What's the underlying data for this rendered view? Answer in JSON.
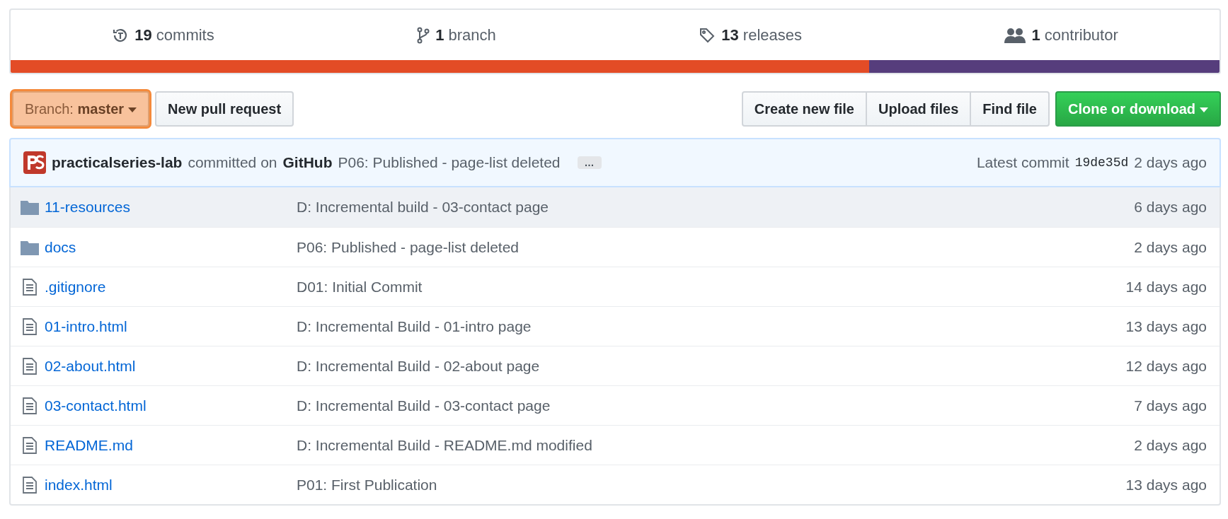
{
  "stats": [
    {
      "kind": "commits",
      "count": "19",
      "label": "commits"
    },
    {
      "kind": "branch",
      "count": "1",
      "label": "branch"
    },
    {
      "kind": "releases",
      "count": "13",
      "label": "releases"
    },
    {
      "kind": "contributors",
      "count": "1",
      "label": "contributor"
    }
  ],
  "languages": [
    {
      "color": "#e34c26",
      "level": 0.71
    },
    {
      "color": "#563d7c",
      "level": 0.29
    }
  ],
  "branch_button": {
    "label": "Branch:",
    "value": "master",
    "focused": true
  },
  "pull_request_button": "New pull request",
  "file_buttons": [
    "Create new file",
    "Upload files",
    "Find file"
  ],
  "clone_button": "Clone or download",
  "latest_commit": {
    "author": "practicalseries-lab",
    "action": "committed on",
    "platform": "GitHub",
    "message": "P06: Published - page-list deleted",
    "more": "…",
    "label": "Latest commit",
    "sha": "19de35d",
    "age": "2 days ago"
  },
  "files": [
    {
      "kind": "folder",
      "name": "11-resources",
      "message": "D: Incremental build - 03-contact page",
      "age": "6 days ago",
      "selected": true
    },
    {
      "kind": "folder",
      "name": "docs",
      "message": "P06: Published - page-list deleted",
      "age": "2 days ago",
      "selected": false
    },
    {
      "kind": "file",
      "name": ".gitignore",
      "message": "D01: Initial Commit",
      "age": "14 days ago",
      "selected": false
    },
    {
      "kind": "file",
      "name": "01-intro.html",
      "message": "D: Incremental Build - 01-intro page",
      "age": "13 days ago",
      "selected": false
    },
    {
      "kind": "file",
      "name": "02-about.html",
      "message": "D: Incremental Build - 02-about page",
      "age": "12 days ago",
      "selected": false
    },
    {
      "kind": "file",
      "name": "03-contact.html",
      "message": "D: Incremental Build - 03-contact page",
      "age": "7 days ago",
      "selected": false
    },
    {
      "kind": "file",
      "name": "README.md",
      "message": "D: Incremental Build - README.md modified",
      "age": "2 days ago",
      "selected": false
    },
    {
      "kind": "file",
      "name": "index.html",
      "message": "P01: First Publication",
      "age": "13 days ago",
      "selected": false
    }
  ]
}
